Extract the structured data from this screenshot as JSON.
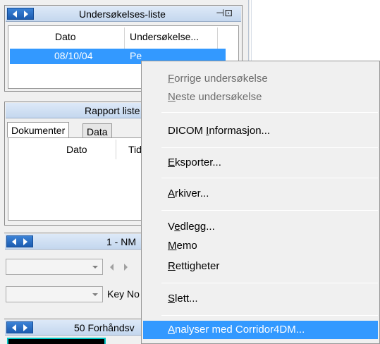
{
  "panel1": {
    "title": "Undersøkelses-liste",
    "col_dato": "Dato",
    "col_undersokelse": "Undersøkelse...",
    "row_date": "08/10/04",
    "row_partial": "Pe"
  },
  "panel2": {
    "title": "Rapport liste",
    "tab_dokumenter": "Dokumenter",
    "tab_data": "Data",
    "col_dato": "Dato",
    "col_tid": "Tid"
  },
  "panel3": {
    "title": "1 - NM",
    "keyno_label": "Key No"
  },
  "panel4": {
    "title": "50 Forhåndsv"
  },
  "menu": {
    "items": [
      {
        "pre": "",
        "key": "F",
        "post": "orrige undersøkelse"
      },
      {
        "pre": "",
        "key": "N",
        "post": "este undersøkelse"
      },
      {
        "pre": "DICOM ",
        "key": "I",
        "post": "nformasjon..."
      },
      {
        "pre": "",
        "key": "E",
        "post": "ksporter..."
      },
      {
        "pre": "",
        "key": "A",
        "post": "rkiver..."
      },
      {
        "pre": "V",
        "key": "e",
        "post": "dlegg..."
      },
      {
        "pre": "",
        "key": "M",
        "post": "emo"
      },
      {
        "pre": "",
        "key": "R",
        "post": "ettigheter"
      },
      {
        "pre": "",
        "key": "S",
        "post": "lett..."
      },
      {
        "pre": "",
        "key": "A",
        "post": "nalyser med Corridor4DM..."
      }
    ]
  },
  "colors": {
    "selection": "#3399ff",
    "titlebar_nav": "#1c5cb0",
    "disabled_text": "#6d6d6d"
  },
  "icons": {
    "nav_prev": "triangle-left",
    "nav_next": "triangle-right",
    "pin": "pin-icon"
  }
}
